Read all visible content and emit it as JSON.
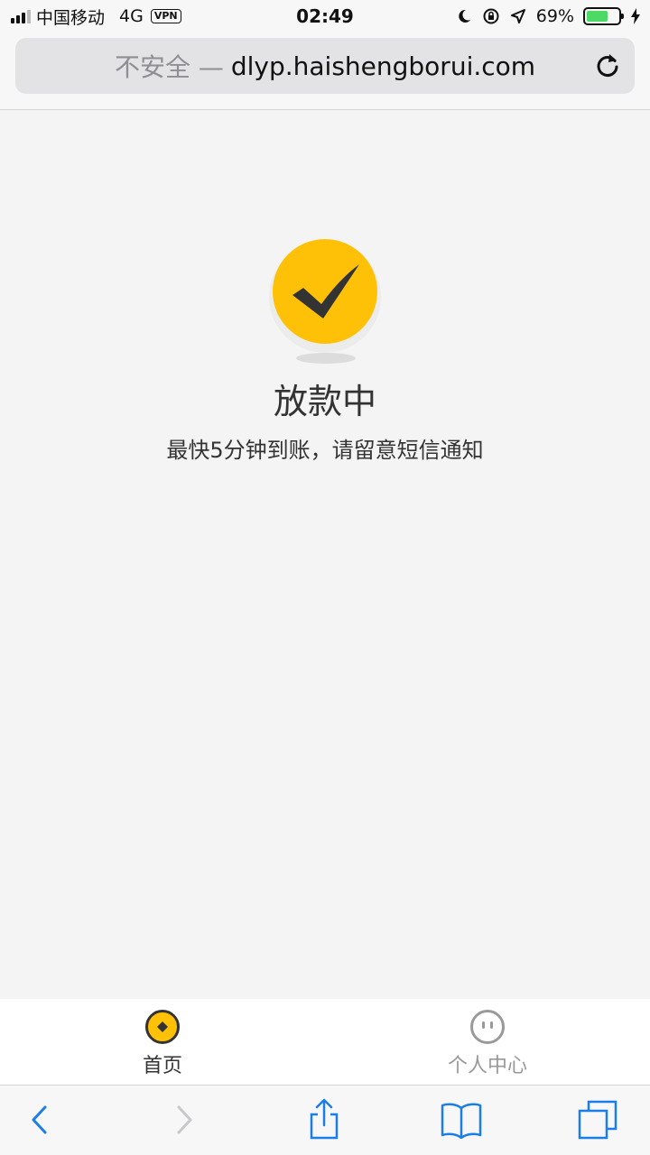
{
  "status_bar": {
    "carrier": "中国移动",
    "network": "4G",
    "vpn": "VPN",
    "time": "02:49",
    "battery_percent": "69%",
    "battery_level": 0.69,
    "icons": [
      "signal-icon",
      "moon-icon",
      "rotation-lock-icon",
      "location-icon",
      "battery-icon",
      "charging-icon"
    ]
  },
  "browser": {
    "insecure_label": "不安全 —",
    "domain": "dlyp.haishengborui.com"
  },
  "main": {
    "status_title": "放款中",
    "status_subtitle": "最快5分钟到账，请留意短信通知"
  },
  "tabs": [
    {
      "label": "首页",
      "active": true,
      "icon": "coin-icon"
    },
    {
      "label": "个人中心",
      "active": false,
      "icon": "face-icon"
    }
  ],
  "toolbar": {
    "icons": [
      "back-icon",
      "forward-icon",
      "share-icon",
      "bookmarks-icon",
      "tabs-icon"
    ]
  },
  "colors": {
    "accent": "#ffc107",
    "battery": "#4cd964",
    "toolbar_icon": "#1a7ee6",
    "inactive": "#999999"
  }
}
